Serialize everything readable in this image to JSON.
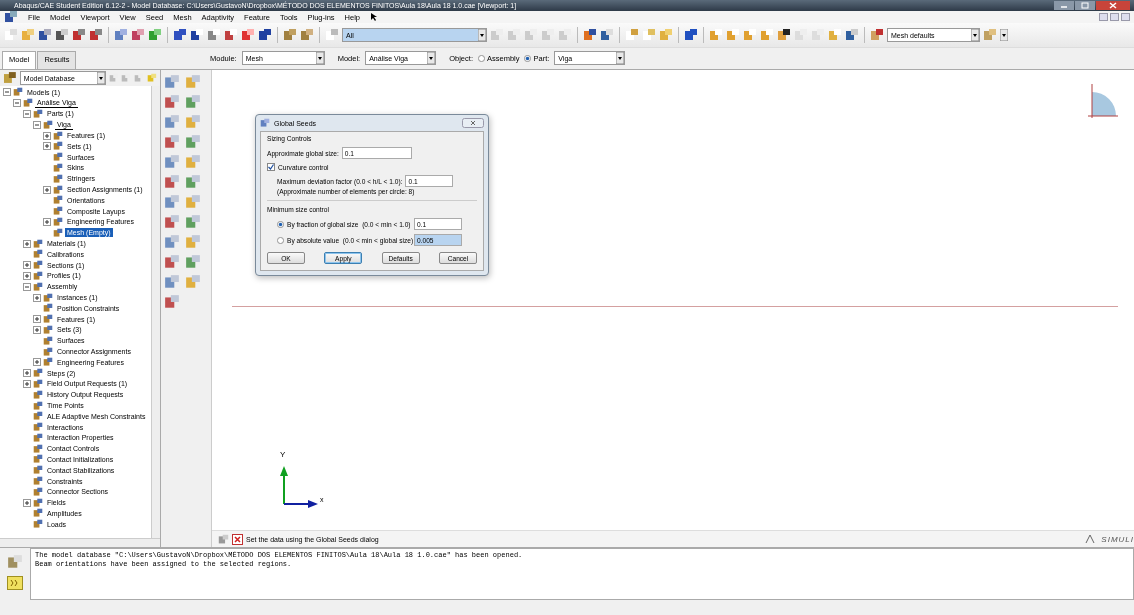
{
  "window": {
    "title": "Abaqus/CAE Student Edition 6.12-2 - Model Database: C:\\Users\\GustavoN\\Dropbox\\MÉTODO DOS ELEMENTOS FINITOS\\Aula 18\\Aula 18 1.0.cae [Viewport: 1]"
  },
  "menu": [
    "File",
    "Model",
    "Viewport",
    "View",
    "Seed",
    "Mesh",
    "Adaptivity",
    "Feature",
    "Tools",
    "Plug-ins",
    "Help"
  ],
  "toolbar": {
    "selection_filter": "All",
    "render_style": "Mesh defaults"
  },
  "panel_tabs": [
    {
      "label": "Model",
      "selected": true
    },
    {
      "label": "Results",
      "selected": false
    }
  ],
  "context": {
    "module_label": "Module:",
    "module": "Mesh",
    "model_label": "Model:",
    "model": "Análise Viga",
    "object_label": "Object:",
    "options": [
      {
        "label": "Assembly",
        "selected": false
      },
      {
        "label": "Part:",
        "selected": true
      }
    ],
    "part": "Viga"
  },
  "tree_source": "Model Database",
  "tree": [
    {
      "label": "Models (1)",
      "expanded": true,
      "selected": false,
      "current": false,
      "children": [
        {
          "label": "Análise Viga",
          "expanded": true,
          "selected": false,
          "current": true,
          "children": [
            {
              "label": "Parts (1)",
              "expanded": true,
              "selected": false,
              "current": false,
              "children": [
                {
                  "label": "Viga",
                  "expanded": true,
                  "selected": false,
                  "current": true,
                  "children": [
                    {
                      "label": "Features (1)",
                      "expanded": false,
                      "selected": false,
                      "current": false
                    },
                    {
                      "label": "Sets (1)",
                      "expanded": false,
                      "selected": false,
                      "current": false
                    },
                    {
                      "label": "Surfaces",
                      "selected": false,
                      "current": false
                    },
                    {
                      "label": "Skins",
                      "selected": false,
                      "current": false
                    },
                    {
                      "label": "Stringers",
                      "selected": false,
                      "current": false
                    },
                    {
                      "label": "Section Assignments (1)",
                      "expanded": false,
                      "selected": false,
                      "current": false
                    },
                    {
                      "label": "Orientations",
                      "selected": false,
                      "current": false
                    },
                    {
                      "label": "Composite Layups",
                      "selected": false,
                      "current": false
                    },
                    {
                      "label": "Engineering Features",
                      "expanded": false,
                      "selected": false,
                      "current": false
                    },
                    {
                      "label": "Mesh (Empty)",
                      "selected": true,
                      "current": false
                    }
                  ]
                }
              ]
            },
            {
              "label": "Materials (1)",
              "expanded": false,
              "selected": false,
              "current": false
            },
            {
              "label": "Calibrations",
              "selected": false,
              "current": false
            },
            {
              "label": "Sections (1)",
              "expanded": false,
              "selected": false,
              "current": false
            },
            {
              "label": "Profiles (1)",
              "expanded": false,
              "selected": false,
              "current": false
            },
            {
              "label": "Assembly",
              "expanded": true,
              "selected": false,
              "current": false,
              "children": [
                {
                  "label": "Instances (1)",
                  "expanded": false,
                  "selected": false,
                  "current": false
                },
                {
                  "label": "Position Constraints",
                  "selected": false,
                  "current": false
                },
                {
                  "label": "Features (1)",
                  "expanded": false,
                  "selected": false,
                  "current": false
                },
                {
                  "label": "Sets (3)",
                  "expanded": false,
                  "selected": false,
                  "current": false
                },
                {
                  "label": "Surfaces",
                  "selected": false,
                  "current": false
                },
                {
                  "label": "Connector Assignments",
                  "selected": false,
                  "current": false
                },
                {
                  "label": "Engineering Features",
                  "expanded": false,
                  "selected": false,
                  "current": false
                }
              ]
            },
            {
              "label": "Steps (2)",
              "expanded": false,
              "selected": false,
              "current": false
            },
            {
              "label": "Field Output Requests (1)",
              "expanded": false,
              "selected": false,
              "current": false
            },
            {
              "label": "History Output Requests",
              "selected": false,
              "current": false
            },
            {
              "label": "Time Points",
              "selected": false,
              "current": false
            },
            {
              "label": "ALE Adaptive Mesh Constraints",
              "selected": false,
              "current": false
            },
            {
              "label": "Interactions",
              "selected": false,
              "current": false
            },
            {
              "label": "Interaction Properties",
              "selected": false,
              "current": false
            },
            {
              "label": "Contact Controls",
              "selected": false,
              "current": false
            },
            {
              "label": "Contact Initializations",
              "selected": false,
              "current": false
            },
            {
              "label": "Contact Stabilizations",
              "selected": false,
              "current": false
            },
            {
              "label": "Constraints",
              "selected": false,
              "current": false
            },
            {
              "label": "Connector Sections",
              "selected": false,
              "current": false
            },
            {
              "label": "Fields",
              "expanded": false,
              "selected": false,
              "current": false
            },
            {
              "label": "Amplitudes",
              "selected": false,
              "current": false
            },
            {
              "label": "Loads",
              "selected": false,
              "current": false
            }
          ]
        }
      ]
    }
  ],
  "dialog": {
    "title": "Global Seeds",
    "group_title": "Sizing Controls",
    "global_size_label": "Approximate global size:",
    "global_size": "0.1",
    "curvature": {
      "label": "Curvature control",
      "checked": true
    },
    "deviation_label": "Maximum deviation factor (0.0 < h/L < 1.0):",
    "deviation": "0.1",
    "note": "(Approximate number of elements per circle: 8)",
    "min_title": "Minimum size control",
    "min_options": [
      {
        "label": "By fraction of global size  (0.0 < min < 1.0)",
        "value": "0.1",
        "selected": true
      },
      {
        "label": "By absolute value  (0.0 < min < global size)",
        "value": "0.005",
        "selected": false
      }
    ],
    "buttons": [
      {
        "label": "OK",
        "focused": false
      },
      {
        "label": "Apply",
        "focused": true
      },
      {
        "label": "Defaults",
        "focused": false
      },
      {
        "label": "Cancel",
        "focused": false
      }
    ]
  },
  "triad": {
    "y": "Y",
    "x": "x"
  },
  "prompt": "Set the data using the Global Seeds dialog",
  "brand": "SIMULI",
  "messages": [
    "The model database \"C:\\Users\\GustavoN\\Dropbox\\MÉTODO DOS ELEMENTOS FINITOS\\Aula 18\\Aula 18 1.0.cae\" has been opened.",
    "Beam orientations have been assigned to the selected regions."
  ]
}
